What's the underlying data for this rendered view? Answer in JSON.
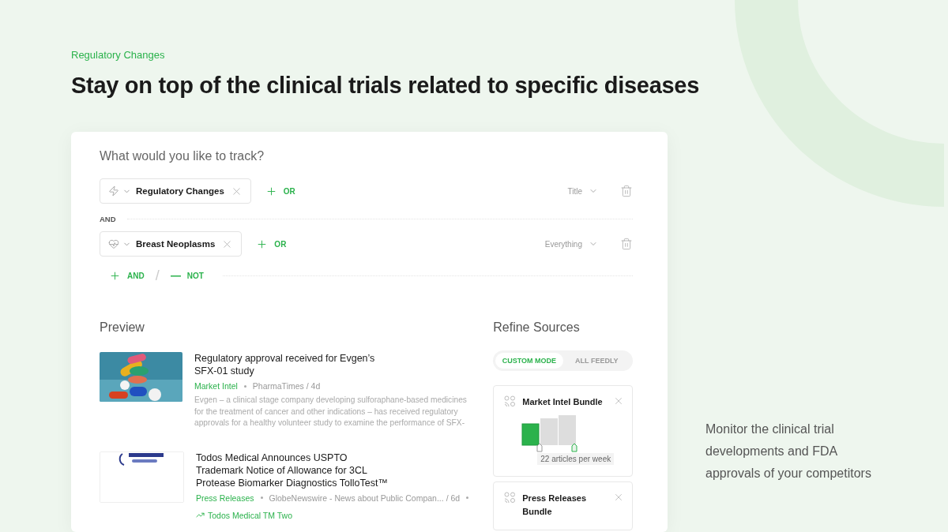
{
  "eyebrow": "Regulatory Changes",
  "headline": "Stay on top of the clinical trials related to specific diseases",
  "tracker": {
    "prompt": "What would you like to track?",
    "groups": [
      {
        "label": "Regulatory Changes",
        "or_label": "OR",
        "scope": "Title"
      },
      {
        "label": "Breast Neoplasms",
        "or_label": "OR",
        "scope": "Everything"
      }
    ],
    "joins": [
      "AND"
    ],
    "actions": [
      {
        "kind": "add",
        "label": "AND"
      },
      {
        "kind": "remove",
        "label": "NOT"
      }
    ],
    "separator": "/"
  },
  "preview": {
    "title": "Preview",
    "articles": [
      {
        "title": "Regulatory approval received for Evgen’s SFX-01 study",
        "feed": "Market Intel",
        "meta": "PharmaTimes / 4d",
        "summary": "Evgen – a clinical stage company developing sulforaphane-based medicines for the treatment of cancer and other indications – has received regulatory approvals for a healthy volunteer study to examine the performance of SFX-"
      },
      {
        "title": "Todos Medical Announces USPTO Trademark Notice of Allowance for 3CL Protease Biomarker Diagnostics TolloTest™",
        "feed": "Press Releases",
        "meta": "GlobeNewswire - News about Public Compan... / 6d",
        "trend": "Todos Medical TM Two"
      }
    ]
  },
  "refine": {
    "title": "Refine Sources",
    "modes": [
      {
        "label": "CUSTOM MODE",
        "selected": true
      },
      {
        "label": "ALL FEEDLY",
        "selected": false
      }
    ],
    "bundles": [
      {
        "name": "Market Intel Bundle",
        "volume": "22 articles per week"
      },
      {
        "name": "Press Releases Bundle"
      }
    ]
  },
  "note": "Monitor the clinical trial developments and FDA approvals of your competitors"
}
